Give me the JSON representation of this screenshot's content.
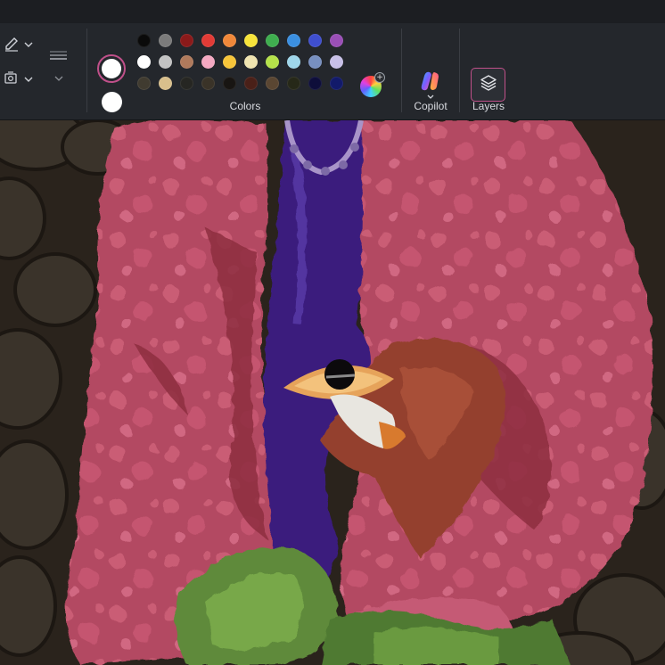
{
  "ribbon": {
    "groups": {
      "colors_label": "Colors",
      "copilot_label": "Copilot",
      "layers_label": "Layers"
    },
    "primary_color": "#ffffff",
    "secondary_color": "#ffffff",
    "palette": [
      [
        "#0a0a0a",
        "#7b7b7b",
        "#8b1a1a",
        "#e23b36",
        "#f0883a",
        "#f7e43b",
        "#3fae4f",
        "#3b8fe0",
        "#3f4fcf",
        "#9a4fb6"
      ],
      [
        "#ffffff",
        "#c3c3c3",
        "#b07a5c",
        "#f4a9c2",
        "#f7c53a",
        "#efe4b0",
        "#b5e24a",
        "#9fd6ea",
        "#7890c0",
        "#c8c0e8"
      ],
      [
        "#403b30",
        "#d8bf8c",
        "#262622",
        "#3a3328",
        "#181512",
        "#4a2018",
        "#5a4632",
        "#262818",
        "#0e0e3a",
        "#121a6a"
      ]
    ],
    "icons": {
      "pencil": "pencil-icon",
      "fill": "fill-icon",
      "brush_size": "brush-size-icon",
      "color_wheel": "color-wheel-icon",
      "copilot": "copilot-icon",
      "layers": "layers-icon"
    },
    "accent": "#c0508a"
  },
  "canvas": {
    "description_colors": {
      "rock": "#2f2922",
      "flesh": "#b7495f",
      "void": "#3a1c7a",
      "leaf": "#5f8f3e"
    }
  }
}
